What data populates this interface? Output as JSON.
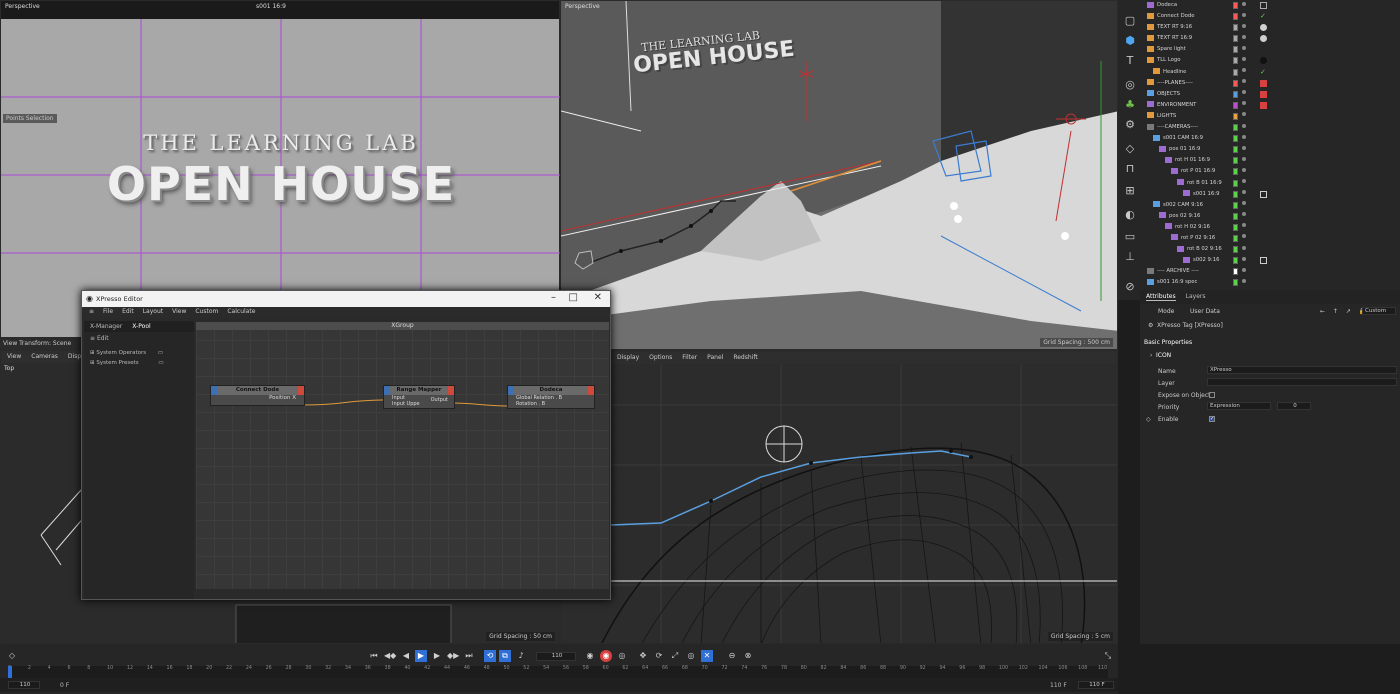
{
  "viewports": {
    "top_left": {
      "title": "Perspective",
      "cam": "s001 16:9",
      "tag": "Points Selection",
      "line1": "THE LEARNING LAB",
      "line2": "OPEN HOUSE"
    },
    "top_right": {
      "title": "Perspective",
      "grid": "Grid Spacing : 500 cm",
      "logo1": "THE LEARNING LAB",
      "logo2": "OPEN HOUSE"
    },
    "bottom_left": {
      "hint": "View Transform: Scene",
      "menu": [
        "View",
        "Cameras",
        "Display"
      ],
      "title": "Top",
      "grid": "Grid Spacing : 50 cm"
    },
    "bottom_right": {
      "menu": [
        "Display",
        "Options",
        "Filter",
        "Panel",
        "Redshift"
      ],
      "grid": "Grid Spacing : 5 cm"
    }
  },
  "xpresso": {
    "title": "XPresso Editor",
    "menu": [
      "File",
      "Edit",
      "Layout",
      "View",
      "Custom",
      "Calculate"
    ],
    "tabs": [
      "X-Manager",
      "X-Pool"
    ],
    "edit_label": "Edit",
    "tree": [
      "System Operators",
      "System Presets"
    ],
    "group": "XGroup",
    "nodes": [
      {
        "title": "Connect Dode",
        "ports": [
          "Position  X"
        ]
      },
      {
        "title": "Range Mapper",
        "ports": [
          "Input",
          "Input Uppe",
          "Output"
        ]
      },
      {
        "title": "Dodeca",
        "ports": [
          "Global Relation . B",
          "Rotation . B"
        ]
      }
    ]
  },
  "objects": [
    {
      "name": "Dodeca",
      "indent": 0,
      "color": "#9e6bd1",
      "dot": "#ff5a5a",
      "tag": "mesh"
    },
    {
      "name": "Connect Dode",
      "indent": 0,
      "color": "#e09a3c",
      "dot": "#ff5a5a",
      "tag": "check"
    },
    {
      "name": "TEXT RT 9:16",
      "indent": 0,
      "color": "#e09a3c",
      "dot": "#aaaaaa",
      "tag": "sphere"
    },
    {
      "name": "TEXT RT 16:9",
      "indent": 0,
      "color": "#e09a3c",
      "dot": "#aaaaaa",
      "tag": "sphere"
    },
    {
      "name": "Spare light",
      "indent": 0,
      "color": "#e09a3c",
      "dot": "#aaaaaa",
      "tag": ""
    },
    {
      "name": "TLL Logo",
      "indent": 0,
      "color": "#e09a3c",
      "dot": "#aaaaaa",
      "tag": "dark"
    },
    {
      "name": "Headline",
      "indent": 1,
      "color": "#e09a3c",
      "dot": "#aaaaaa",
      "tag": "check"
    },
    {
      "name": "----PLANES----",
      "indent": 0,
      "color": "#e09a3c",
      "dot": "#ff5a5a",
      "tag": "red"
    },
    {
      "name": "OBJECTS",
      "indent": 0,
      "color": "#5aa0e0",
      "dot": "#5aa0e0",
      "tag": "red"
    },
    {
      "name": "ENVIRONMENT",
      "indent": 0,
      "color": "#9e6bd1",
      "dot": "#c24bd6",
      "tag": "red"
    },
    {
      "name": "LIGHTS",
      "indent": 0,
      "color": "#e09a3c",
      "dot": "#e8a040",
      "tag": ""
    },
    {
      "name": "----CAMERAS----",
      "indent": 0,
      "color": "#7a7a7a",
      "dot": "#5fd04a",
      "tag": ""
    },
    {
      "name": "s001 CAM 16:9",
      "indent": 1,
      "color": "#5aa0e0",
      "dot": "#5fd04a",
      "tag": ""
    },
    {
      "name": "pos 01 16:9",
      "indent": 2,
      "color": "#9e6bd1",
      "dot": "#5fd04a",
      "tag": ""
    },
    {
      "name": "rot H 01 16:9",
      "indent": 3,
      "color": "#9e6bd1",
      "dot": "#5fd04a",
      "tag": ""
    },
    {
      "name": "rot P 01 16:9",
      "indent": 4,
      "color": "#9e6bd1",
      "dot": "#5fd04a",
      "tag": ""
    },
    {
      "name": "rot B 01 16:9",
      "indent": 5,
      "color": "#9e6bd1",
      "dot": "#5fd04a",
      "tag": ""
    },
    {
      "name": "s001 16:9",
      "indent": 6,
      "color": "#9e6bd1",
      "dot": "#5fd04a",
      "tag": "cam"
    },
    {
      "name": "s002 CAM 9:16",
      "indent": 1,
      "color": "#5aa0e0",
      "dot": "#5fd04a",
      "tag": ""
    },
    {
      "name": "pos 02 9:16",
      "indent": 2,
      "color": "#9e6bd1",
      "dot": "#5fd04a",
      "tag": ""
    },
    {
      "name": "rot H 02 9:16",
      "indent": 3,
      "color": "#9e6bd1",
      "dot": "#5fd04a",
      "tag": ""
    },
    {
      "name": "rot P 02 9:16",
      "indent": 4,
      "color": "#9e6bd1",
      "dot": "#5fd04a",
      "tag": ""
    },
    {
      "name": "rot B 02 9:16",
      "indent": 5,
      "color": "#9e6bd1",
      "dot": "#5fd04a",
      "tag": ""
    },
    {
      "name": "s002 9:16",
      "indent": 6,
      "color": "#9e6bd1",
      "dot": "#5fd04a",
      "tag": "cam"
    },
    {
      "name": "---- ARCHIVE ----",
      "indent": 0,
      "color": "#7a7a7a",
      "dot": "#ffffff",
      "tag": ""
    },
    {
      "name": "s001 16:9 spec",
      "indent": 0,
      "color": "#5aa0e0",
      "dot": "#5fd04a",
      "tag": ""
    }
  ],
  "attributes": {
    "tabs": [
      "Attributes",
      "Layers"
    ],
    "mode": "Mode",
    "user_data": "User Data",
    "tag_name": "XPresso Tag [XPresso]",
    "custom": "Custom",
    "section": "Basic Properties",
    "icon": "ICON",
    "name_label": "Name",
    "name_value": "XPresso",
    "layer_label": "Layer",
    "expose_label": "Expose on Object",
    "priority_label": "Priority",
    "priority_value": "Expression",
    "priority_num": "0",
    "enable_label": "Enable"
  },
  "timeline": {
    "frame_field": "110",
    "ticks": [
      "0",
      "2",
      "4",
      "6",
      "8",
      "10",
      "12",
      "14",
      "16",
      "18",
      "20",
      "22",
      "24",
      "26",
      "28",
      "30",
      "32",
      "34",
      "36",
      "38",
      "40",
      "42",
      "44",
      "46",
      "48",
      "50",
      "52",
      "54",
      "56",
      "58",
      "60",
      "62",
      "64",
      "66",
      "68",
      "70",
      "72",
      "74",
      "76",
      "78",
      "80",
      "82",
      "84",
      "86",
      "88",
      "90",
      "92",
      "94",
      "96",
      "98",
      "100",
      "102",
      "104",
      "106",
      "108",
      "110"
    ],
    "start": "110",
    "current": "0 F",
    "end_label": "110 F",
    "end_field": "110 F"
  },
  "colors": {
    "accent": "#2f6fd6",
    "record": "#d94040"
  }
}
